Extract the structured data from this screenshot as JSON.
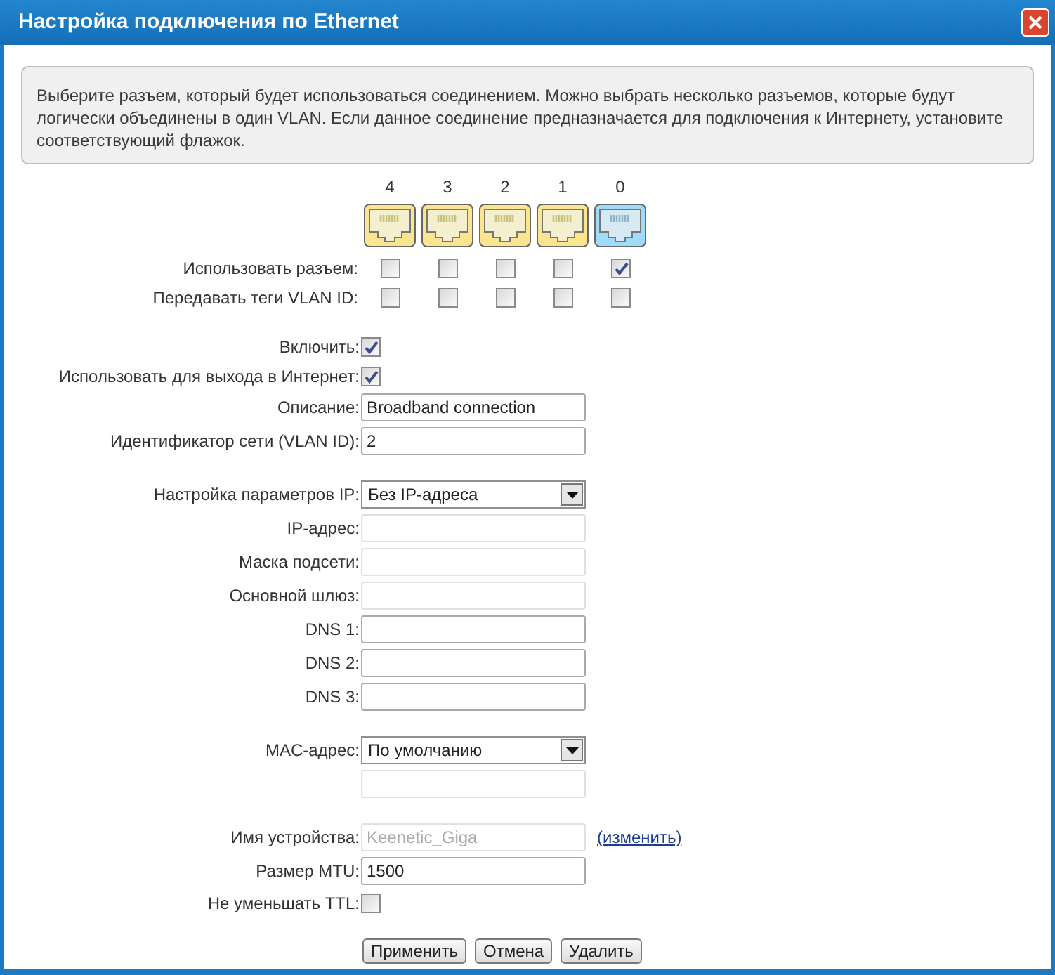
{
  "window": {
    "title": "Настройка подключения по Ethernet"
  },
  "info": "Выберите разъем, который будет использоваться соединением. Можно выбрать несколько разъемов, которые будут логически объединены в один VLAN. Если данное соединение предназначается для подключения к Интернету, установите соответствующий флажок.",
  "ports": [
    {
      "label": "4",
      "active": false
    },
    {
      "label": "3",
      "active": false
    },
    {
      "label": "2",
      "active": false
    },
    {
      "label": "1",
      "active": false
    },
    {
      "label": "0",
      "active": true
    }
  ],
  "port_rows": [
    {
      "label": "Использовать разъем:",
      "checked": [
        false,
        false,
        false,
        false,
        true
      ]
    },
    {
      "label": "Передавать теги VLAN ID:",
      "checked": [
        false,
        false,
        false,
        false,
        false
      ]
    }
  ],
  "sections": [
    [
      {
        "kind": "checkbox",
        "label": "Включить:",
        "checked": true
      },
      {
        "kind": "checkbox",
        "label": "Использовать для выхода в Интернет:",
        "checked": true
      },
      {
        "kind": "text",
        "label": "Описание:",
        "value": "Broadband connection",
        "disabled": false
      },
      {
        "kind": "text",
        "label": "Идентификатор сети (VLAN ID):",
        "value": "2",
        "disabled": false
      }
    ],
    [
      {
        "kind": "select",
        "label": "Настройка параметров IP:",
        "value": "Без IP-адреса"
      },
      {
        "kind": "text",
        "label": "IP-адрес:",
        "disabled": true
      },
      {
        "kind": "text",
        "label": "Маска подсети:",
        "disabled": true
      },
      {
        "kind": "text",
        "label": "Основной шлюз:",
        "disabled": true
      },
      {
        "kind": "text",
        "label": "DNS 1:",
        "disabled": false
      },
      {
        "kind": "text",
        "label": "DNS 2:",
        "disabled": false
      },
      {
        "kind": "text",
        "label": "DNS 3:",
        "disabled": false
      }
    ],
    [
      {
        "kind": "select",
        "label": "MAC-адрес:",
        "value": "По умолчанию"
      },
      {
        "kind": "text",
        "disabled": true
      }
    ],
    [
      {
        "kind": "text",
        "label": "Имя устройства:",
        "value": "Keenetic_Giga",
        "disabled": true,
        "link": "(изменить)"
      },
      {
        "kind": "text",
        "label": "Размер MTU:",
        "value": "1500",
        "disabled": false
      },
      {
        "kind": "checkbox",
        "label": "Не уменьшать TTL:",
        "checked": false
      }
    ]
  ],
  "buttons": [
    "Применить",
    "Отмена",
    "Удалить"
  ]
}
